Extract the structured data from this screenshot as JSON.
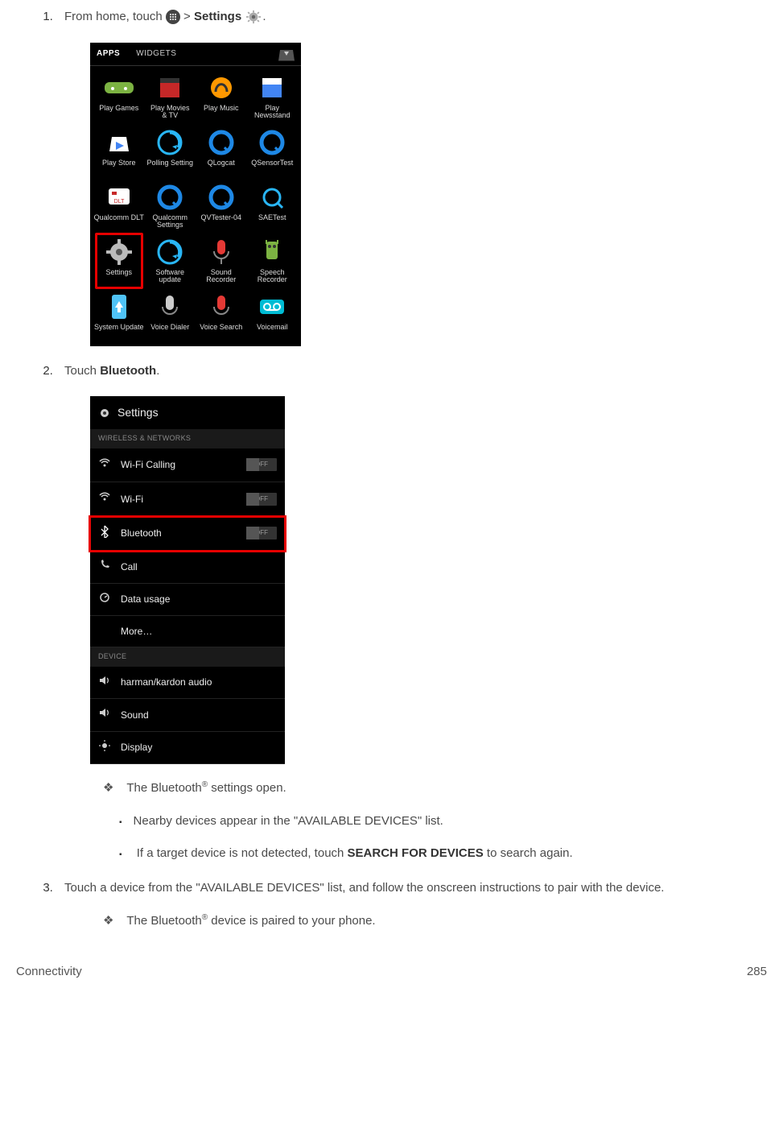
{
  "step1": {
    "prefix": "From home, touch ",
    "gt": " > ",
    "settings_word": "Settings",
    "suffix": "."
  },
  "apps_screen": {
    "tabs": {
      "apps": "APPS",
      "widgets": "WIDGETS"
    },
    "apps": [
      {
        "label": "Play Games"
      },
      {
        "label": "Play Movies\n& TV"
      },
      {
        "label": "Play Music"
      },
      {
        "label": "Play Newsstand"
      },
      {
        "label": "Play Store"
      },
      {
        "label": "Polling Setting"
      },
      {
        "label": "QLogcat"
      },
      {
        "label": "QSensorTest"
      },
      {
        "label": "Qualcomm DLT"
      },
      {
        "label": "Qualcomm Settings"
      },
      {
        "label": "QVTester-04"
      },
      {
        "label": "SAETest"
      },
      {
        "label": "Settings",
        "highlight": true
      },
      {
        "label": "Software update"
      },
      {
        "label": "Sound Recorder"
      },
      {
        "label": "Speech Recorder"
      },
      {
        "label": "System Update"
      },
      {
        "label": "Voice Dialer"
      },
      {
        "label": "Voice Search"
      },
      {
        "label": "Voicemail"
      }
    ]
  },
  "step2": {
    "prefix": "Touch ",
    "bold": "Bluetooth",
    "suffix": "."
  },
  "settings_screen": {
    "title": "Settings",
    "section1": "WIRELESS & NETWORKS",
    "rows1": [
      {
        "icon": "wifi",
        "label": "Wi-Fi Calling",
        "toggle": "OFF"
      },
      {
        "icon": "wifi",
        "label": "Wi-Fi",
        "toggle": "OFF"
      },
      {
        "icon": "bt",
        "label": "Bluetooth",
        "toggle": "OFF",
        "highlight": true
      },
      {
        "icon": "phone",
        "label": "Call"
      },
      {
        "icon": "data",
        "label": "Data usage"
      },
      {
        "icon": "",
        "label": "More…"
      }
    ],
    "section2": "DEVICE",
    "rows2": [
      {
        "icon": "vol",
        "label": "harman/kardon audio"
      },
      {
        "icon": "vol",
        "label": "Sound"
      },
      {
        "icon": "disp",
        "label": "Display"
      }
    ]
  },
  "bullets": {
    "d1a": "The Bluetooth",
    "d1b": " settings open.",
    "s1": "Nearby devices appear in the \"AVAILABLE DEVICES\" list.",
    "s2a": "If a target device is not detected, touch ",
    "s2b": "SEARCH FOR DEVICES",
    "s2c": " to search again.",
    "step3": "Touch a device from the \"AVAILABLE DEVICES\" list, and follow the onscreen instructions to pair with the device.",
    "d2a": "The Bluetooth",
    "d2b": " device is paired to your phone."
  },
  "footer": {
    "left": "Connectivity",
    "right": "285"
  },
  "reg": "®",
  "toggle_off": "OFF"
}
